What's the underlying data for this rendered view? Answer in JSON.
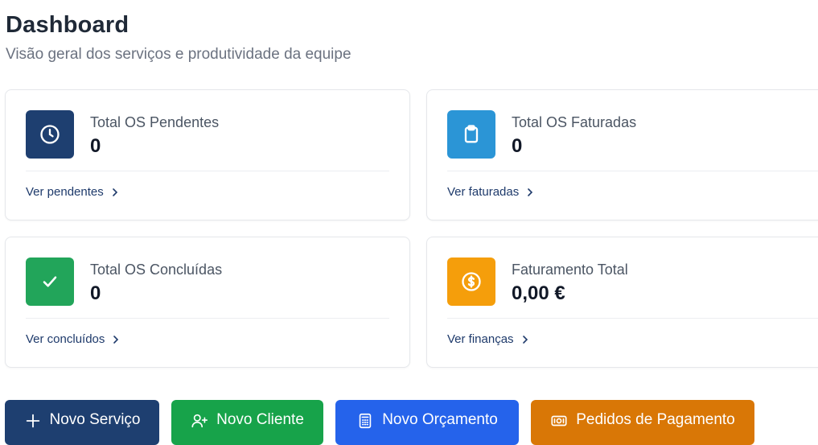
{
  "header": {
    "title": "Dashboard",
    "subtitle": "Visão geral dos serviços e produtividade da equipe"
  },
  "cards": [
    {
      "label": "Total OS Pendentes",
      "value": "0",
      "link": "Ver pendentes",
      "icon": "clock-icon",
      "color": "#1e3f70"
    },
    {
      "label": "Total OS Faturadas",
      "value": "0",
      "link": "Ver faturadas",
      "icon": "clipboard-icon",
      "color": "#2b95d6"
    },
    {
      "label": "Total OS Concluídas",
      "value": "0",
      "link": "Ver concluídos",
      "icon": "check-icon",
      "color": "#22a55a"
    },
    {
      "label": "Faturamento Total",
      "value": "0,00 €",
      "link": "Ver finanças",
      "icon": "dollar-circle-icon",
      "color": "#f59e0b"
    }
  ],
  "actions": [
    {
      "label": "Novo Serviço",
      "icon": "plus-icon",
      "color": "#1e3f70"
    },
    {
      "label": "Novo Cliente",
      "icon": "user-plus-icon",
      "color": "#17a34a"
    },
    {
      "label": "Novo Orçamento",
      "icon": "calculator-icon",
      "color": "#2563eb"
    },
    {
      "label": "Pedidos de Pagamento",
      "icon": "cash-icon",
      "color": "#d97706"
    }
  ]
}
